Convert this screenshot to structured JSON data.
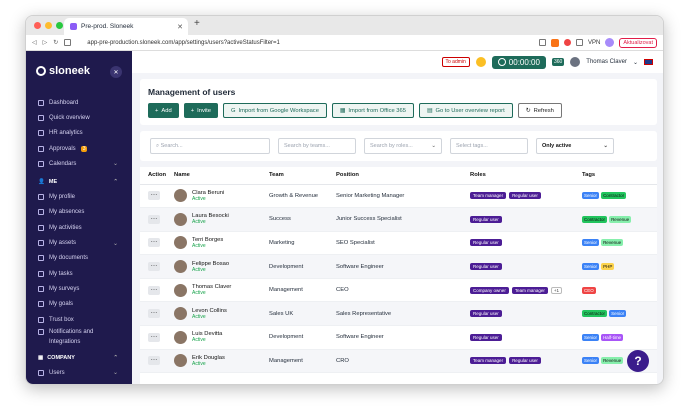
{
  "browser": {
    "tab_title": "Pre-prod. Sloneek",
    "url": "app-pre-production.sloneek.com/app/settings/users?activeStatusFilter=1",
    "vpn_label": "VPN",
    "update_label": "Aktualizovat"
  },
  "sidebar": {
    "logo": "sloneek",
    "items": [
      {
        "label": "Dashboard",
        "icon": "dashboard-icon"
      },
      {
        "label": "Quick overview",
        "icon": "overview-icon"
      },
      {
        "label": "HR analytics",
        "icon": "analytics-icon"
      },
      {
        "label": "Approvals",
        "icon": "approvals-icon",
        "badge": "3"
      },
      {
        "label": "Calendars",
        "icon": "calendar-icon",
        "chevron": true
      }
    ],
    "me_section": "ME",
    "me_items": [
      {
        "label": "My profile"
      },
      {
        "label": "My absences"
      },
      {
        "label": "My activities"
      },
      {
        "label": "My assets"
      },
      {
        "label": "My documents"
      },
      {
        "label": "My tasks"
      },
      {
        "label": "My surveys"
      },
      {
        "label": "My goals"
      },
      {
        "label": "Trust box"
      },
      {
        "label": "Notifications and"
      },
      {
        "label": "Integrations"
      }
    ],
    "company_section": "COMPANY",
    "company_items": [
      {
        "label": "Users"
      }
    ]
  },
  "topbar": {
    "to_admin": "To admin",
    "timer": "00:00:00",
    "badge": "360",
    "user_name": "Thomas Claver"
  },
  "page": {
    "title": "Management of users",
    "buttons": {
      "add": "Add",
      "invite": "Invite",
      "import_google": "Import from Google Workspace",
      "import_office": "Import from Office 365",
      "overview_report": "Go to User overview report",
      "refresh": "Refresh"
    }
  },
  "filters": {
    "search_placeholder": "Search...",
    "teams_placeholder": "Search by teams...",
    "roles_placeholder": "Search by roles...",
    "tags_placeholder": "Select tags...",
    "status_value": "Only active"
  },
  "table": {
    "headers": [
      "Action",
      "Name",
      "Team",
      "Position",
      "Roles",
      "Tags"
    ],
    "rows": [
      {
        "name": "Clara Beruni",
        "status": "Active",
        "team": "Growth & Revenue",
        "position": "Senior Marketing Manager",
        "roles": [
          "Team manager",
          "Regular user"
        ],
        "tags": [
          [
            "Senior",
            "t-senior"
          ],
          [
            "Contractor",
            "t-contractor"
          ]
        ]
      },
      {
        "name": "Laura Besocki",
        "status": "Active",
        "team": "Success",
        "position": "Junior Success Specialist",
        "roles": [
          "Regular user"
        ],
        "tags": [
          [
            "Contractor",
            "t-contractor"
          ],
          [
            "Revenue",
            "t-revenue"
          ]
        ]
      },
      {
        "name": "Terri Borges",
        "status": "Active",
        "team": "Marketing",
        "position": "SEO Specialist",
        "roles": [
          "Regular user"
        ],
        "tags": [
          [
            "Senior",
            "t-senior"
          ],
          [
            "Revenue",
            "t-revenue"
          ]
        ]
      },
      {
        "name": "Felippe Bosao",
        "status": "Active",
        "team": "Development",
        "position": "Software Engineer",
        "roles": [
          "Regular user"
        ],
        "tags": [
          [
            "Senior",
            "t-senior"
          ],
          [
            "PHP",
            "t-php"
          ]
        ]
      },
      {
        "name": "Thomas Claver",
        "status": "Active",
        "team": "Management",
        "position": "CEO",
        "roles": [
          "Company owner",
          "Team manager"
        ],
        "roles_more": "+1",
        "tags": [
          [
            "CEO",
            "t-ceo"
          ]
        ]
      },
      {
        "name": "Levon Collins",
        "status": "Active",
        "team": "Sales UK",
        "position": "Sales Representative",
        "roles": [
          "Regular user"
        ],
        "tags": [
          [
            "Contractor",
            "t-contractor"
          ],
          [
            "Senior",
            "t-senior"
          ]
        ]
      },
      {
        "name": "Luis Devitta",
        "status": "Active",
        "team": "Development",
        "position": "Software Engineer",
        "roles": [
          "Regular user"
        ],
        "tags": [
          [
            "Senior",
            "t-senior"
          ],
          [
            "Half-time",
            "t-halftime"
          ]
        ]
      },
      {
        "name": "Erik Douglas",
        "status": "Active",
        "team": "Management",
        "position": "CRO",
        "roles": [
          "Team manager",
          "Regular user"
        ],
        "tags": [
          [
            "Senior",
            "t-senior"
          ],
          [
            "Revenue",
            "t-revenue"
          ]
        ]
      }
    ]
  },
  "help_label": "?"
}
